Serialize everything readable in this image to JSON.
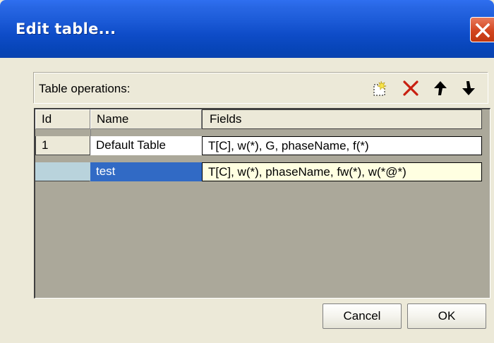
{
  "dialog": {
    "title": "Edit table...",
    "close_icon": "close-icon",
    "close_color": "#d2451f"
  },
  "operations": {
    "label": "Table operations:",
    "tools": [
      {
        "name": "new-table-icon",
        "tooltip": ""
      },
      {
        "name": "delete-icon",
        "color": "#c81f10"
      },
      {
        "name": "move-up-icon"
      },
      {
        "name": "move-down-icon"
      }
    ]
  },
  "table": {
    "columns": [
      "Id",
      "Name",
      "Fields"
    ],
    "rows": [
      {
        "id": "1",
        "name": "Default Table",
        "fields": "T[C], w(*), G, phaseName, f(*)",
        "selected": false
      },
      {
        "id": "",
        "name": "test",
        "fields": "T[C], w(*), phaseName, fw(*), w(*@*)",
        "selected": true
      }
    ],
    "selection_color": "#316ac5",
    "empty_area_color": "#aba89a"
  },
  "buttons": {
    "cancel": "Cancel",
    "ok": "OK"
  }
}
